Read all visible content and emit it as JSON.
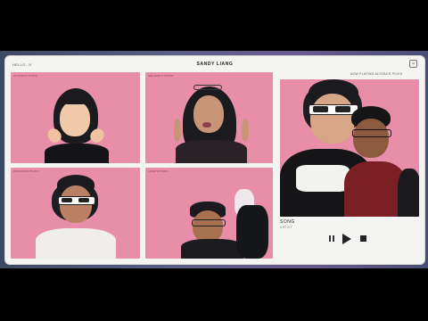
{
  "header": {
    "greeting": "HELLO, !!!",
    "title": "SANDY LIANG",
    "smile_icon": "smile-icon"
  },
  "grid": [
    {
      "label": "ALYSSA'S PICKS"
    },
    {
      "label": "MELISSA'S PICKS"
    },
    {
      "label": "BROOKS'S PICKS"
    },
    {
      "label": "LUKE'S PICKS"
    }
  ],
  "player": {
    "now_playing": "NOW PLAYING ALYSSA'S PICKS",
    "song": "SONG",
    "artist": "ARTIST",
    "pause_icon": "pause-icon",
    "play_icon": "play-icon",
    "stop_icon": "stop-icon"
  },
  "colors": {
    "backdrop": "#e88ea9",
    "window": "#f4f4f2"
  }
}
